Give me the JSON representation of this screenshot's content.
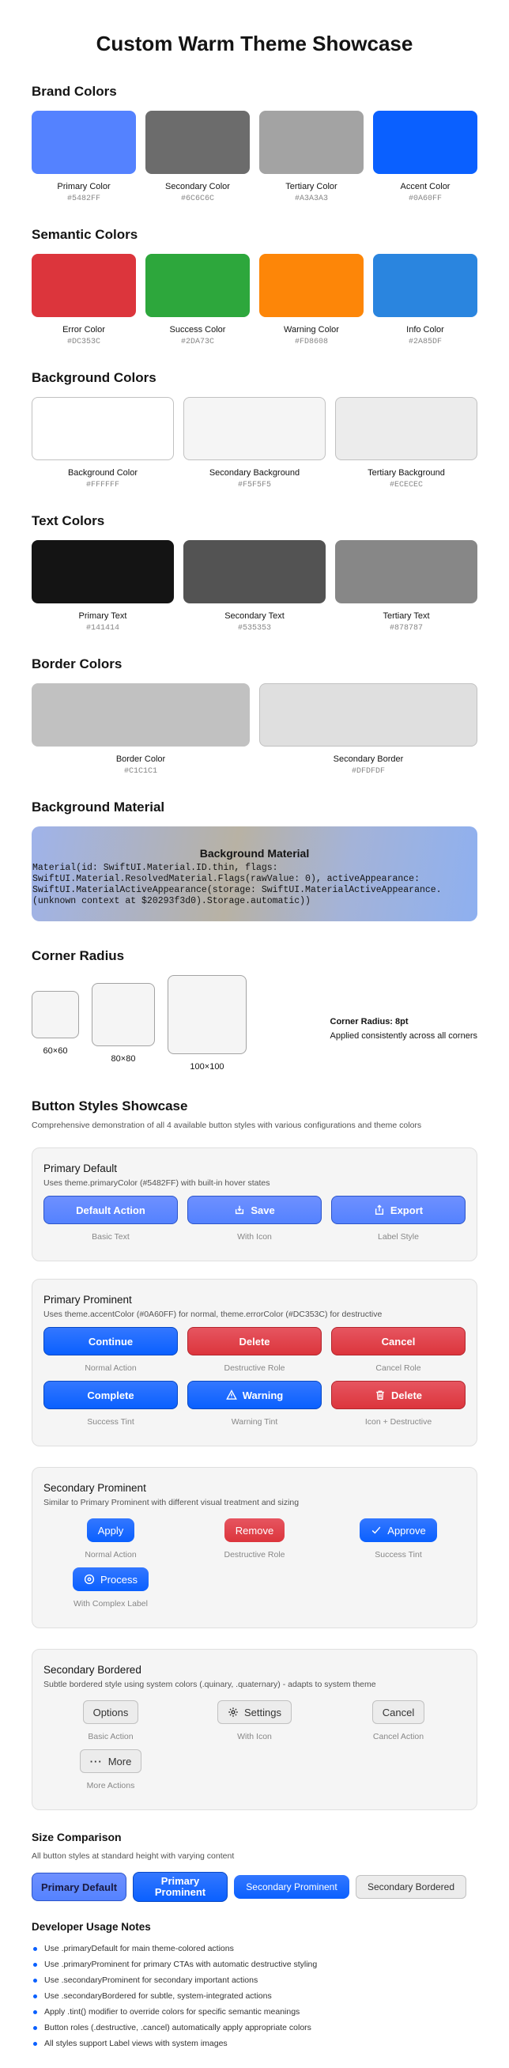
{
  "title": "Custom Warm Theme Showcase",
  "brand": {
    "title": "Brand Colors",
    "items": [
      {
        "name": "Primary Color",
        "hex": "#5482FF"
      },
      {
        "name": "Secondary Color",
        "hex": "#6C6C6C"
      },
      {
        "name": "Tertiary Color",
        "hex": "#A3A3A3"
      },
      {
        "name": "Accent Color",
        "hex": "#0A60FF"
      }
    ]
  },
  "semantic": {
    "title": "Semantic Colors",
    "items": [
      {
        "name": "Error Color",
        "hex": "#DC353C"
      },
      {
        "name": "Success Color",
        "hex": "#2DA73C"
      },
      {
        "name": "Warning Color",
        "hex": "#FD8608"
      },
      {
        "name": "Info Color",
        "hex": "#2A85DF"
      }
    ]
  },
  "background": {
    "title": "Background Colors",
    "items": [
      {
        "name": "Background Color",
        "hex": "#FFFFFF"
      },
      {
        "name": "Secondary Background",
        "hex": "#F5F5F5"
      },
      {
        "name": "Tertiary Background",
        "hex": "#ECECEC"
      }
    ]
  },
  "text": {
    "title": "Text Colors",
    "items": [
      {
        "name": "Primary Text",
        "hex": "#141414"
      },
      {
        "name": "Secondary Text",
        "hex": "#535353"
      },
      {
        "name": "Tertiary Text",
        "hex": "#878787"
      }
    ]
  },
  "border": {
    "title": "Border Colors",
    "items": [
      {
        "name": "Border Color",
        "hex": "#C1C1C1"
      },
      {
        "name": "Secondary Border",
        "hex": "#DFDFDF"
      }
    ]
  },
  "material": {
    "title": "Background Material",
    "card_title": "Background Material",
    "desc": "Material(id: SwiftUI.Material.ID.thin, flags: SwiftUI.Material.ResolvedMaterial.Flags(rawValue: 0), activeAppearance: SwiftUI.MaterialActiveAppearance(storage: SwiftUI.MaterialActiveAppearance.(unknown context at $20293f3d0).Storage.automatic))"
  },
  "radius": {
    "title": "Corner Radius",
    "boxes": [
      "60×60",
      "80×80",
      "100×100"
    ],
    "info_title": "Corner Radius: 8pt",
    "info_sub": "Applied consistently across all corners"
  },
  "showcase": {
    "title": "Button Styles Showcase",
    "subtitle": "Comprehensive demonstration of all 4 available button styles with various configurations and theme colors"
  },
  "primary_default": {
    "title": "Primary Default",
    "subtitle": "Uses theme.primaryColor (#5482FF) with built-in hover states",
    "buttons": [
      {
        "label": "Default Action",
        "caption": "Basic Text"
      },
      {
        "label": "Save",
        "caption": "With Icon"
      },
      {
        "label": "Export",
        "caption": "Label Style"
      }
    ]
  },
  "primary_prominent": {
    "title": "Primary Prominent",
    "subtitle": "Uses theme.accentColor (#0A60FF) for normal, theme.errorColor (#DC353C) for destructive",
    "buttons": [
      {
        "label": "Continue",
        "caption": "Normal Action"
      },
      {
        "label": "Delete",
        "caption": "Destructive Role"
      },
      {
        "label": "Cancel",
        "caption": "Cancel Role"
      },
      {
        "label": "Complete",
        "caption": "Success Tint"
      },
      {
        "label": "Warning",
        "caption": "Warning Tint"
      },
      {
        "label": "Delete",
        "caption": "Icon + Destructive"
      }
    ]
  },
  "secondary_prominent": {
    "title": "Secondary Prominent",
    "subtitle": "Similar to Primary Prominent with different visual treatment and sizing",
    "buttons": [
      {
        "label": "Apply",
        "caption": "Normal Action"
      },
      {
        "label": "Remove",
        "caption": "Destructive Role"
      },
      {
        "label": "Approve",
        "caption": "Success Tint"
      },
      {
        "label": "Process",
        "caption": "With Complex Label"
      }
    ]
  },
  "secondary_bordered": {
    "title": "Secondary Bordered",
    "subtitle": "Subtle bordered style using system colors (.quinary, .quaternary) - adapts to system theme",
    "buttons": [
      {
        "label": "Options",
        "caption": "Basic Action"
      },
      {
        "label": "Settings",
        "caption": "With Icon"
      },
      {
        "label": "Cancel",
        "caption": "Cancel Action"
      },
      {
        "label": "More",
        "caption": "More Actions"
      }
    ]
  },
  "size": {
    "title": "Size Comparison",
    "subtitle": "All button styles at standard height with varying content",
    "buttons": [
      "Primary Default",
      "Primary Prominent",
      "Secondary Prominent",
      "Secondary Bordered"
    ]
  },
  "dev": {
    "title": "Developer Usage Notes",
    "notes": [
      "Use .primaryDefault for main theme-colored actions",
      "Use .primaryProminent for primary CTAs with automatic destructive styling",
      "Use .secondaryProminent for secondary important actions",
      "Use .secondaryBordered for subtle, system-integrated actions",
      "Apply .tint() modifier to override colors for specific semantic meanings",
      "Button roles (.destructive, .cancel) automatically apply appropriate colors",
      "All styles support Label views with system images"
    ]
  }
}
